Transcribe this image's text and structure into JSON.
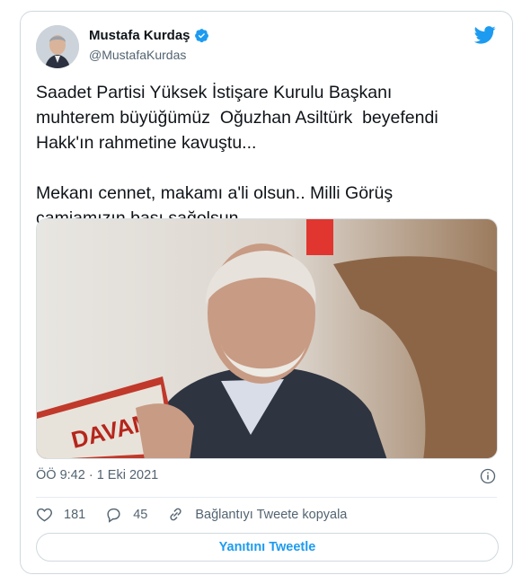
{
  "author": {
    "name": "Mustafa Kurdaş",
    "handle": "@MustafaKurdas"
  },
  "tweet": {
    "text": "Saadet Partisi Yüksek İstişare Kurulu Başkanı\nmuhterem büyüğümüz  Oğuzhan Asiltürk  beyefendi\nHakk'ın rahmetine kavuştu...\n\nMekanı cennet, makamı a'li olsun.. Milli Görüş\ncamiamızın başı sağolsun..",
    "image_caption_text": "DAVAM",
    "timestamp": "ÖÖ 9:42 · 1 Eki 2021"
  },
  "actions": {
    "likes": "181",
    "replies": "45",
    "copy_link": "Bağlantıyı Tweete kopyala",
    "reply_button": "Yanıtını Tweetle"
  },
  "colors": {
    "accent": "#1d9bf0",
    "secondary_text": "#536471",
    "border": "#cfd9de"
  },
  "icons": [
    "verified-badge-icon",
    "twitter-bird-icon",
    "info-icon",
    "heart-icon",
    "reply-icon",
    "link-icon"
  ]
}
